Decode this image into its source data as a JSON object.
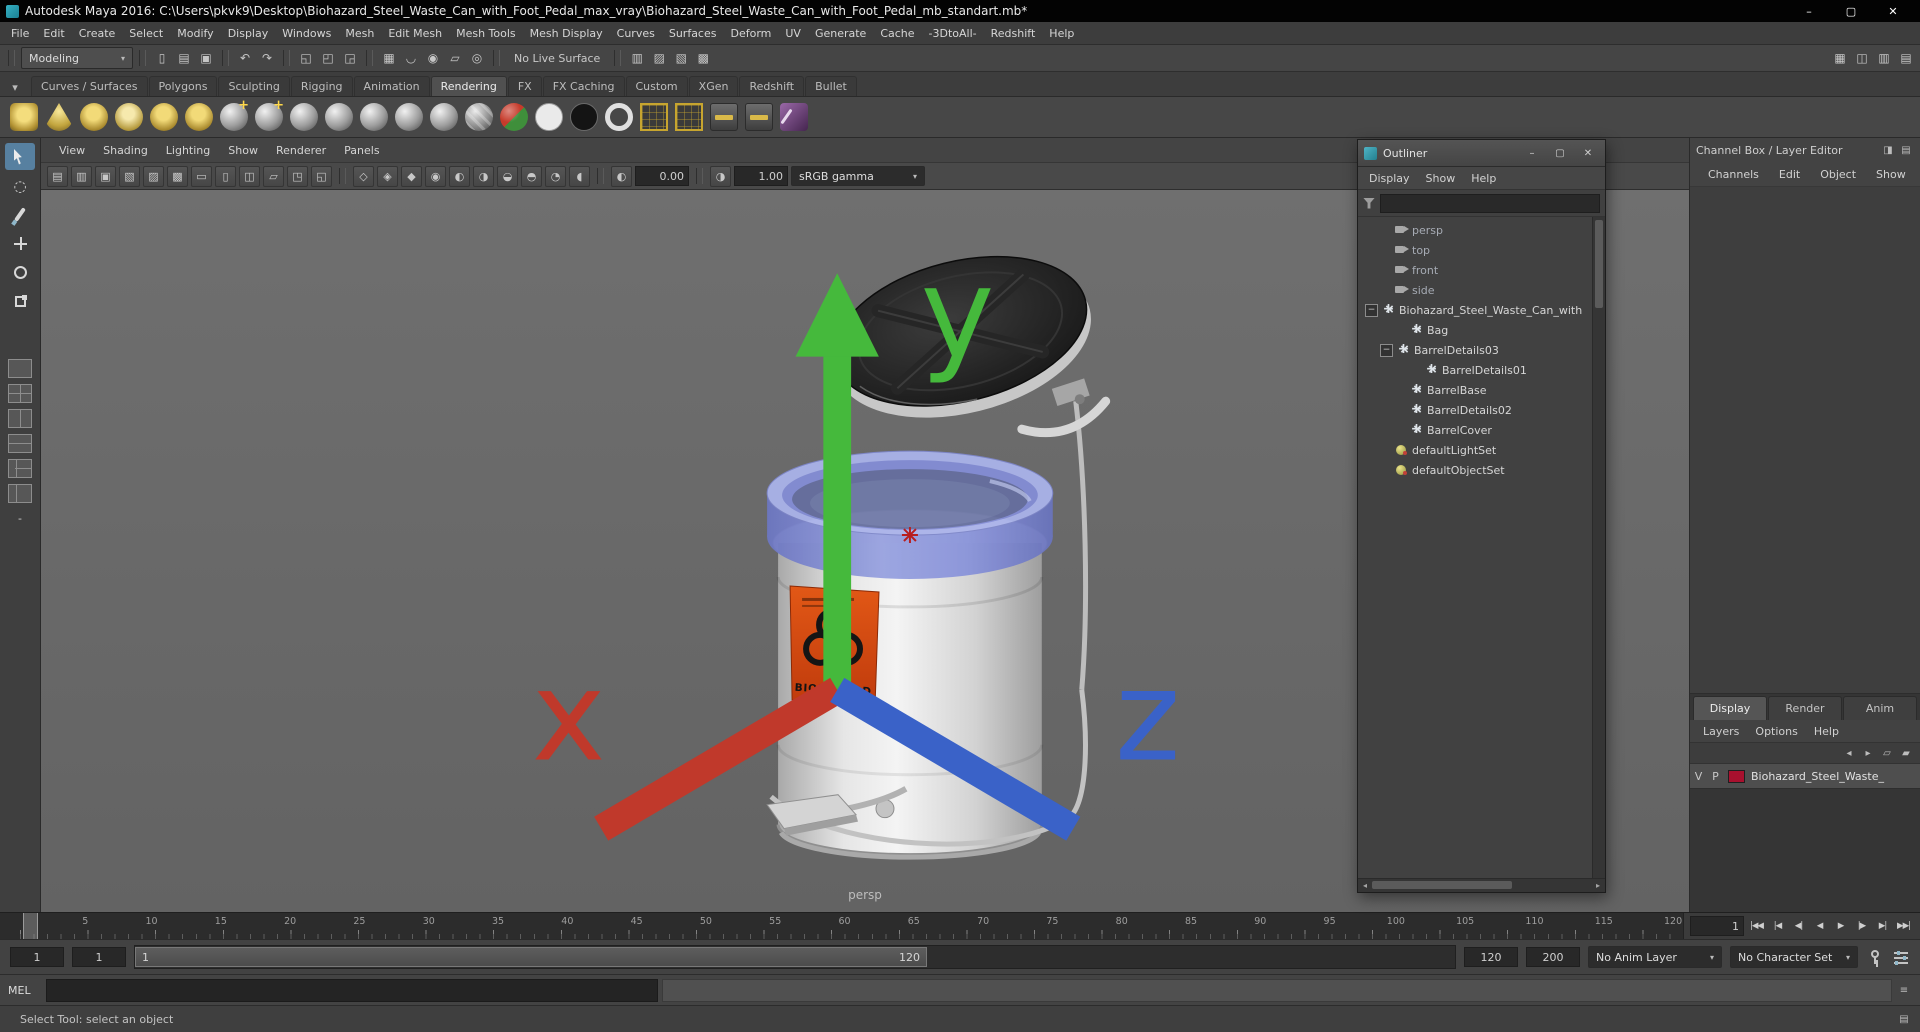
{
  "colors": {
    "accent_blue": "#5780a0",
    "layer_swatch_red": "#a8102e",
    "label_orange": "#d54a12",
    "liner_blue": "#7e88d6",
    "viewport_gray": "#696969"
  },
  "window": {
    "title": "Autodesk Maya 2016: C:\\Users\\pkvk9\\Desktop\\Biohazard_Steel_Waste_Can_with_Foot_Pedal_max_vray\\Biohazard_Steel_Waste_Can_with_Foot_Pedal_mb_standart.mb*",
    "minimize": "–",
    "maximize": "▢",
    "close": "✕"
  },
  "menubar": {
    "items": [
      "File",
      "Edit",
      "Create",
      "Select",
      "Modify",
      "Display",
      "Windows",
      "Mesh",
      "Edit Mesh",
      "Mesh Tools",
      "Mesh Display",
      "Curves",
      "Surfaces",
      "Deform",
      "UV",
      "Generate",
      "Cache",
      "-3DtoAll-",
      "Redshift",
      "Help"
    ]
  },
  "statusline": {
    "mode": "Modeling",
    "dd_arrow": "▾",
    "live_surface": "No Live Surface",
    "file_icons": [
      {
        "name": "new-scene-button",
        "glyph": "▯"
      },
      {
        "name": "open-scene-button",
        "glyph": "▤"
      },
      {
        "name": "save-scene-button",
        "glyph": "▣"
      }
    ],
    "undo_icons": [
      {
        "name": "undo-button",
        "glyph": "↶"
      },
      {
        "name": "redo-button",
        "glyph": "↷"
      }
    ],
    "selection_icons": [
      {
        "name": "select-hierarchy-button",
        "glyph": "◱"
      },
      {
        "name": "select-object-button",
        "glyph": "◰"
      },
      {
        "name": "select-component-button",
        "glyph": "◲"
      }
    ],
    "snap_icons": [
      {
        "name": "snap-to-grid-button",
        "glyph": "▦"
      },
      {
        "name": "snap-to-curve-button",
        "glyph": "◡"
      },
      {
        "name": "snap-to-point-button",
        "glyph": "◉"
      },
      {
        "name": "snap-to-plane-button",
        "glyph": "▱"
      },
      {
        "name": "make-live-button",
        "glyph": "◎"
      }
    ],
    "render_icons": [
      {
        "name": "open-render-view-button",
        "glyph": "▥"
      },
      {
        "name": "render-current-frame-button",
        "glyph": "▨"
      },
      {
        "name": "ipr-render-button",
        "glyph": "▧"
      },
      {
        "name": "render-settings-button",
        "glyph": "▩"
      }
    ],
    "sidebar_icons": [
      {
        "name": "toggle-modeling-toolkit-button",
        "glyph": "▦"
      },
      {
        "name": "toggle-attribute-editor-button",
        "glyph": "◫"
      },
      {
        "name": "toggle-tool-settings-button",
        "glyph": "▥"
      },
      {
        "name": "toggle-channel-box-button",
        "glyph": "▤"
      }
    ]
  },
  "shelf": {
    "tabs": [
      {
        "label": "Curves / Surfaces"
      },
      {
        "label": "Polygons"
      },
      {
        "label": "Sculpting"
      },
      {
        "label": "Rigging"
      },
      {
        "label": "Animation"
      },
      {
        "label": "Rendering",
        "active": true
      },
      {
        "label": "FX"
      },
      {
        "label": "FX Caching"
      },
      {
        "label": "Custom"
      },
      {
        "label": "XGen"
      },
      {
        "label": "Redshift"
      },
      {
        "label": "Bullet"
      }
    ],
    "items": [
      {
        "name": "shelf-ambient-light-button",
        "kind": "light1"
      },
      {
        "name": "shelf-spot-light-button",
        "kind": "light2"
      },
      {
        "name": "shelf-point-light-button",
        "kind": "light3"
      },
      {
        "name": "shelf-directional-light-button",
        "kind": "light4"
      },
      {
        "name": "shelf-area-light-button",
        "kind": "light5"
      },
      {
        "name": "shelf-volume-light-button",
        "kind": "light6"
      },
      {
        "name": "shelf-assign-blinn-button",
        "kind": "ball-plus"
      },
      {
        "name": "shelf-assign-lambert-button",
        "kind": "ball-plus"
      },
      {
        "name": "shelf-material-1-button",
        "kind": "ball"
      },
      {
        "name": "shelf-material-2-button",
        "kind": "ball"
      },
      {
        "name": "shelf-material-3-button",
        "kind": "ball"
      },
      {
        "name": "shelf-material-4-button",
        "kind": "ball"
      },
      {
        "name": "shelf-material-5-button",
        "kind": "ball"
      },
      {
        "name": "shelf-use-background-button",
        "kind": "ball-striped"
      },
      {
        "name": "shelf-shading-map-button",
        "kind": "ball-rg"
      },
      {
        "name": "shelf-surface-shader-button",
        "kind": "disc-white"
      },
      {
        "name": "shelf-black-hole-shader-button",
        "kind": "disc-black"
      },
      {
        "name": "shelf-ramp-shader-button",
        "kind": "ring-white"
      },
      {
        "name": "shelf-uv-editor-button",
        "kind": "grid-yellow"
      },
      {
        "name": "shelf-uv-snapshot-button",
        "kind": "grid-yellow"
      },
      {
        "name": "shelf-clamp-a-button",
        "kind": "clamp"
      },
      {
        "name": "shelf-clamp-b-button",
        "kind": "clamp"
      },
      {
        "name": "shelf-paint-effects-button",
        "kind": "brushfx"
      }
    ]
  },
  "toolbox": {
    "tools": [
      {
        "name": "select-tool",
        "kind": "t-arrow",
        "active": true
      },
      {
        "name": "lasso-select-tool",
        "kind": "t-lasso"
      },
      {
        "name": "paint-select-tool",
        "kind": "t-brush"
      },
      {
        "name": "move-tool",
        "kind": "t-move"
      },
      {
        "name": "rotate-tool",
        "kind": "t-rotate"
      },
      {
        "name": "scale-tool",
        "kind": "t-scale"
      }
    ],
    "layouts": [
      {
        "name": "layout-single-pane-button",
        "kind": "p1"
      },
      {
        "name": "layout-four-pane-button",
        "kind": "p4"
      },
      {
        "name": "layout-two-pane-side-button",
        "kind": "p2v"
      },
      {
        "name": "layout-two-pane-stacked-button",
        "kind": "p2h"
      },
      {
        "name": "layout-three-pane-button",
        "kind": "p3"
      },
      {
        "name": "layout-outliner-persp-button",
        "kind": "pop"
      }
    ],
    "more_label": "-"
  },
  "viewport": {
    "panel_menus": [
      "View",
      "Shading",
      "Lighting",
      "Show",
      "Renderer",
      "Panels"
    ],
    "camera_label": "persp",
    "model_label": "BIOHAZARD",
    "axis_x": "x",
    "axis_y": "y",
    "axis_z": "z",
    "toolbar": {
      "icons_left": [
        {
          "name": "select-camera-icon",
          "glyph": "▤"
        },
        {
          "name": "lock-camera-icon",
          "glyph": "▥"
        },
        {
          "name": "camera-attributes-icon",
          "glyph": "▣"
        },
        {
          "name": "bookmarks-icon",
          "glyph": "▧"
        },
        {
          "name": "image-plane-icon",
          "glyph": "▨"
        },
        {
          "name": "view-grid-icon",
          "glyph": "▩"
        },
        {
          "name": "film-gate-icon",
          "glyph": "▭"
        },
        {
          "name": "resolution-gate-icon",
          "glyph": "▯"
        },
        {
          "name": "gate-mask-icon",
          "glyph": "◫"
        },
        {
          "name": "field-chart-icon",
          "glyph": "▱"
        },
        {
          "name": "safe-action-icon",
          "glyph": "◳"
        },
        {
          "name": "safe-title-icon",
          "glyph": "◱"
        }
      ],
      "icons_mid": [
        {
          "name": "wireframe-icon",
          "glyph": "◇"
        },
        {
          "name": "smooth-shade-icon",
          "glyph": "◈"
        },
        {
          "name": "textured-icon",
          "glyph": "◆"
        },
        {
          "name": "use-all-lights-icon",
          "glyph": "◉"
        },
        {
          "name": "shadows-icon",
          "glyph": "◐"
        },
        {
          "name": "screen-space-ao-icon",
          "glyph": "◑"
        },
        {
          "name": "motion-blur-icon",
          "glyph": "◒"
        },
        {
          "name": "multisample-icon",
          "glyph": "◓"
        },
        {
          "name": "isolate-select-icon",
          "glyph": "◔"
        },
        {
          "name": "xray-icon",
          "glyph": "◖"
        }
      ],
      "exposure": "0.00",
      "gamma": "1.00",
      "view_transform": "sRGB gamma",
      "dd_arrow": "▾",
      "exposure_icon": "◐",
      "gamma_icon": "◑"
    }
  },
  "outliner": {
    "title": "Outliner",
    "buttons": {
      "minimize": "–",
      "maximize": "▢",
      "close": "✕"
    },
    "menus": [
      "Display",
      "Show",
      "Help"
    ],
    "items": [
      {
        "label": "persp",
        "icon": "camera",
        "indent": 1,
        "dim": true
      },
      {
        "label": "top",
        "icon": "camera",
        "indent": 1,
        "dim": true
      },
      {
        "label": "front",
        "icon": "camera",
        "indent": 1,
        "dim": true
      },
      {
        "label": "side",
        "icon": "camera",
        "indent": 1,
        "dim": true
      },
      {
        "label": "Biohazard_Steel_Waste_Can_with",
        "icon": "transform",
        "indent": 0,
        "exp": "−"
      },
      {
        "label": "Bag",
        "icon": "transform",
        "indent": 2
      },
      {
        "label": "BarrelDetails03",
        "icon": "transform",
        "indent": 1,
        "exp": "−"
      },
      {
        "label": "BarrelDetails01",
        "icon": "transform",
        "indent": 3
      },
      {
        "label": "BarrelBase",
        "icon": "transform",
        "indent": 2
      },
      {
        "label": "BarrelDetails02",
        "icon": "transform",
        "indent": 2
      },
      {
        "label": "BarrelCover",
        "icon": "transform",
        "indent": 2
      },
      {
        "label": "defaultLightSet",
        "icon": "set",
        "indent": 1
      },
      {
        "label": "defaultObjectSet",
        "icon": "set",
        "indent": 1
      }
    ],
    "hscroll": {
      "left": "◂",
      "right": "▸"
    }
  },
  "channel_box": {
    "header": "Channel Box / Layer Editor",
    "header_icons": [
      {
        "name": "panel-pin-icon",
        "glyph": "◨"
      },
      {
        "name": "panel-menu-icon",
        "glyph": "▤"
      }
    ],
    "menus": [
      "Channels",
      "Edit",
      "Object",
      "Show"
    ]
  },
  "layer_editor": {
    "tabs": [
      {
        "label": "Display",
        "active": true
      },
      {
        "label": "Render"
      },
      {
        "label": "Anim"
      }
    ],
    "menus": [
      "Layers",
      "Options",
      "Help"
    ],
    "toolbar_icons": [
      {
        "name": "layer-move-up-icon",
        "glyph": "◂"
      },
      {
        "name": "layer-move-down-icon",
        "glyph": "▸"
      },
      {
        "name": "create-empty-layer-icon",
        "glyph": "▱"
      },
      {
        "name": "create-layer-from-selected-icon",
        "glyph": "▰"
      }
    ],
    "layer": {
      "visibility": "V",
      "playback": "P",
      "color": "#a8102e",
      "name": "Biohazard_Steel_Waste_"
    }
  },
  "timeline": {
    "ticks": [
      "5",
      "10",
      "15",
      "20",
      "25",
      "30",
      "35",
      "40",
      "45",
      "50",
      "55",
      "60",
      "65",
      "70",
      "75",
      "80",
      "85",
      "90",
      "95",
      "100",
      "105",
      "110",
      "115",
      "120"
    ],
    "current_frame": "1",
    "transport": [
      {
        "name": "go-to-start-button",
        "glyph": "|◀◀"
      },
      {
        "name": "step-back-frame-button",
        "glyph": "|◀"
      },
      {
        "name": "step-back-key-button",
        "glyph": "◀|"
      },
      {
        "name": "play-backwards-button",
        "glyph": "◀"
      },
      {
        "name": "play-forwards-button",
        "glyph": "▶"
      },
      {
        "name": "step-forward-key-button",
        "glyph": "|▶"
      },
      {
        "name": "step-forward-frame-button",
        "glyph": "▶|"
      },
      {
        "name": "go-to-end-button",
        "glyph": "▶▶|"
      }
    ]
  },
  "range_slider": {
    "anim_start": "1",
    "playback_start": "1",
    "handle_start_label": "1",
    "handle_end_label": "120",
    "playback_end": "120",
    "anim_end": "200",
    "anim_layer": "No Anim Layer",
    "character_set": "No Character Set",
    "dd_arrow": "▾"
  },
  "command_line": {
    "label": "MEL"
  },
  "help_line": {
    "text": "Select Tool: select an object"
  }
}
